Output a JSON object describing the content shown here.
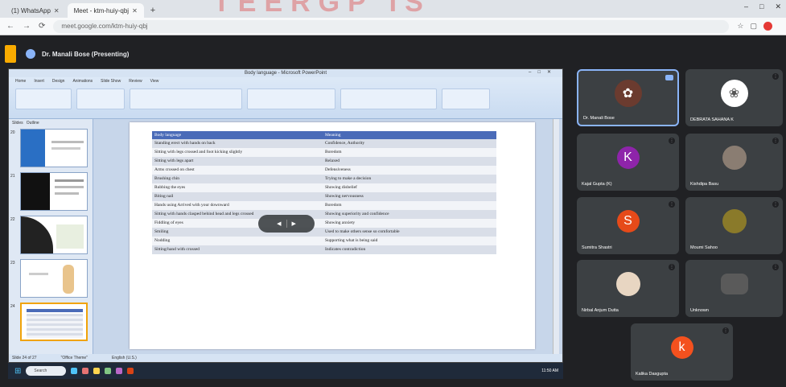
{
  "browser": {
    "tabs": [
      {
        "label": "(1) WhatsApp",
        "active": false
      },
      {
        "label": "Meet - ktm-huiy-qbj",
        "active": true
      }
    ],
    "url": "meet.google.com/ktm-huiy-qbj",
    "window_controls": [
      "–",
      "□",
      "✕"
    ]
  },
  "meet": {
    "presenter_label": "Dr. Manali Bose (Presenting)"
  },
  "powerpoint": {
    "title": "Body language - Microsoft PowerPoint",
    "ribbon_tabs": [
      "Home",
      "Insert",
      "Design",
      "Animations",
      "Slide Show",
      "Review",
      "View"
    ],
    "outline_tabs": [
      "Slides",
      "Outline"
    ],
    "thumb_numbers": [
      "20",
      "21",
      "22",
      "23",
      "24"
    ],
    "status": [
      "Slide 24 of 27",
      "\"Office Theme\"",
      "English (U.S.)"
    ]
  },
  "table": {
    "headers": [
      "Body language",
      "Meaning"
    ],
    "rows": [
      [
        "Standing erect with hands on back",
        "Confidence, Authority"
      ],
      [
        "Sitting with legs crossed and foot kicking slightly",
        "Boredom"
      ],
      [
        "Sitting with legs apart",
        "Relaxed"
      ],
      [
        "Arms crossed on chest",
        "Defensiveness"
      ],
      [
        "Brushing chin",
        "Trying to make a decision"
      ],
      [
        "Rubbing the eyes",
        "Showing disbelief"
      ],
      [
        "Biting nail",
        "Showing nervousness"
      ],
      [
        "Hands using Arrived with your downward",
        "Boredom"
      ],
      [
        "Sitting with hands clasped behind head and legs crossed",
        "Showing superiority and confidence"
      ],
      [
        "Fiddling of eyes",
        "Showing anxiety"
      ],
      [
        "Smiling",
        "Used to make others sense so comfortable"
      ],
      [
        "Nodding",
        "Supporting what is being said"
      ],
      [
        "Sitting/hand with crossed",
        "Indicates contradiction"
      ]
    ]
  },
  "controls_pill": {
    "left": "◀",
    "right": "▶"
  },
  "taskbar": {
    "search_placeholder": "Search",
    "clock": "11:50 AM"
  },
  "participants": [
    {
      "name": "Dr. Manali Bose",
      "avatar_letter": "",
      "avatar_color": "#6b3b2f",
      "active": true
    },
    {
      "name": "DEBRATA SAHANA K",
      "avatar_letter": "",
      "avatar_color": "#ffffff"
    },
    {
      "name": "Kajal Gupta (K)",
      "avatar_letter": "K",
      "avatar_color": "#8e24aa"
    },
    {
      "name": "Kishdipa Basu",
      "avatar_letter": "",
      "avatar_color": "#8a7d72"
    },
    {
      "name": "Sumitra Shastri",
      "avatar_letter": "S",
      "avatar_color": "#e64a19"
    },
    {
      "name": "Moumi Sahoo",
      "avatar_letter": "",
      "avatar_color": "#8a7a2a"
    },
    {
      "name": "Nirbal Anjum Dutta",
      "avatar_letter": "",
      "avatar_color": "#e8d6c2"
    },
    {
      "name": "Unknown",
      "avatar_letter": "",
      "avatar_color": "#5a5a5a"
    },
    {
      "name": "Kalika Dasgupta",
      "avatar_letter": "k",
      "avatar_color": "#f4511e"
    }
  ],
  "watermark": "TEERGP IS"
}
